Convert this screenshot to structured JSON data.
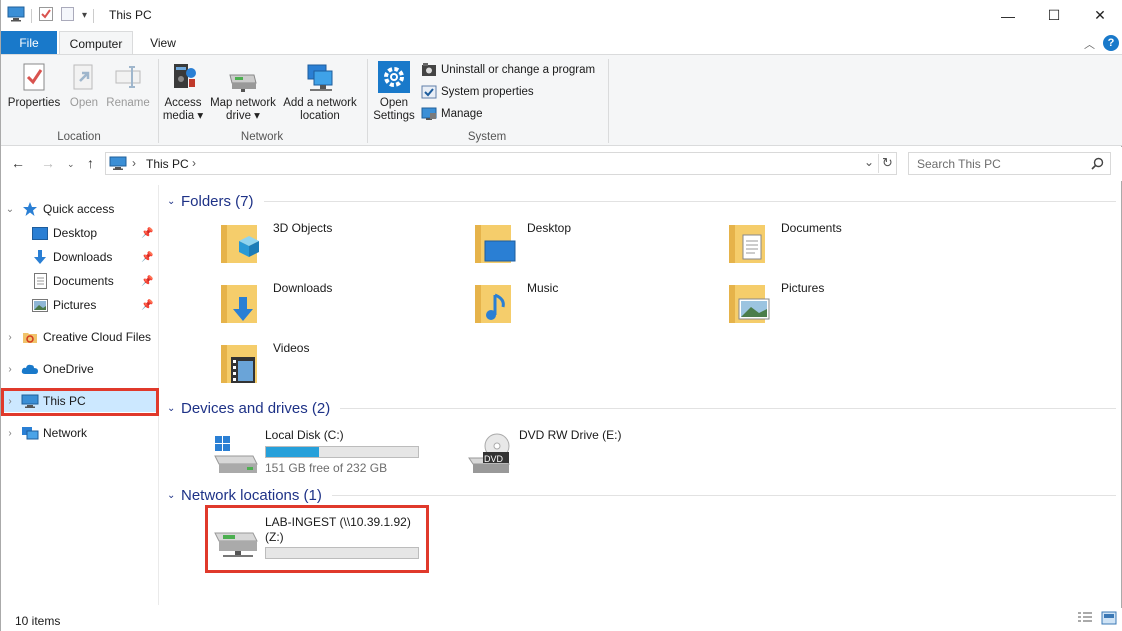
{
  "window": {
    "title": "This PC",
    "quick_access_dropdown": "▾",
    "controls": {
      "minimize": "—",
      "maximize": "☐",
      "close": "✕"
    }
  },
  "ribbon": {
    "tabs": [
      {
        "label": "File"
      },
      {
        "label": "Computer"
      },
      {
        "label": "View"
      }
    ],
    "groups": {
      "location": {
        "label": "Location",
        "buttons": [
          {
            "label": "Properties",
            "icon": "properties-icon",
            "enabled": true
          },
          {
            "label": "Open",
            "icon": "open-icon",
            "enabled": false
          },
          {
            "label": "Rename",
            "icon": "rename-icon",
            "enabled": false
          }
        ]
      },
      "network": {
        "label": "Network",
        "access_media": {
          "line1": "Access",
          "line2": "media ▾"
        },
        "map_network_drive": {
          "line1": "Map network",
          "line2": "drive ▾"
        },
        "add_network_location": {
          "line1": "Add a network",
          "line2": "location"
        }
      },
      "system": {
        "label": "System",
        "open_settings": {
          "line1": "Open",
          "line2": "Settings"
        },
        "uninstall": "Uninstall or change a program",
        "system_properties": "System properties",
        "manage": "Manage"
      }
    }
  },
  "address": {
    "breadcrumb": "This PC",
    "sep": "›",
    "search_placeholder": "Search This PC"
  },
  "nav_pane": {
    "quick_access": "Quick access",
    "quick_items": [
      {
        "label": "Desktop"
      },
      {
        "label": "Downloads"
      },
      {
        "label": "Documents"
      },
      {
        "label": "Pictures"
      }
    ],
    "creative_cloud": "Creative Cloud Files",
    "onedrive": "OneDrive",
    "this_pc": "This PC",
    "network": "Network"
  },
  "content": {
    "folders_section": "Folders (7)",
    "folders": [
      {
        "name": "3D Objects",
        "icon": "3d-objects-folder-icon"
      },
      {
        "name": "Desktop",
        "icon": "desktop-folder-icon"
      },
      {
        "name": "Documents",
        "icon": "documents-folder-icon"
      },
      {
        "name": "Downloads",
        "icon": "downloads-folder-icon"
      },
      {
        "name": "Music",
        "icon": "music-folder-icon"
      },
      {
        "name": "Pictures",
        "icon": "pictures-folder-icon"
      },
      {
        "name": "Videos",
        "icon": "videos-folder-icon"
      }
    ],
    "devices_section": "Devices and drives (2)",
    "local_disk": {
      "name": "Local Disk (C:)",
      "free": "151 GB free of 232 GB",
      "used_fraction": 0.35
    },
    "dvd": {
      "name": "DVD RW Drive (E:)",
      "badge": "DVD"
    },
    "network_section": "Network locations (1)",
    "net_drive": {
      "name_line1": "LAB-INGEST (\\\\10.39.1.92)",
      "name_line2": "(Z:)",
      "used_fraction": 0
    }
  },
  "status": {
    "items_count": "10 items"
  },
  "colors": {
    "accent": "#1979ca",
    "section_title": "#1e3287",
    "selection": "#cce8ff",
    "highlight_box": "#e0392b",
    "bar_fill": "#26a0da"
  }
}
